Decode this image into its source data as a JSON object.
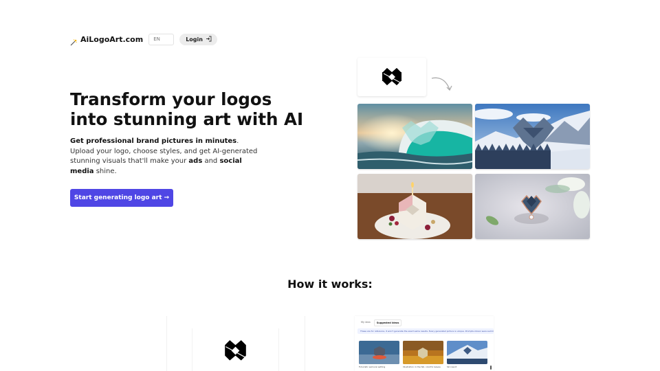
{
  "header": {
    "brand_icon": "magic-wand-icon",
    "brand_name": "AiLogoArt.com",
    "language": "EN",
    "login_label": "Login",
    "login_icon": "sign-in-icon"
  },
  "hero": {
    "title_line1": "Transform your logos",
    "title_line2": "into stunning art with AI",
    "desc_bold1": "Get professional brand pictures in minutes",
    "desc_text1": ".",
    "desc_text2": "Upload your logo, choose styles, and get AI-generated stunning visuals that'll make your ",
    "desc_bold2": "ads",
    "desc_text3": " and ",
    "desc_bold3": "social media",
    "desc_text4": " shine.",
    "cta_label": "Start generating logo art →",
    "cta_color": "#4f46e5"
  },
  "gallery": {
    "source_logo": "diamond-logo-icon",
    "arrow": "curved-arrow-icon",
    "images": [
      {
        "name": "ocean-wave-logo-art",
        "alt": "Logo as ocean wave at sunset"
      },
      {
        "name": "mountain-ski-logo-art",
        "alt": "Logo in snowy mountain landscape"
      },
      {
        "name": "cake-candle-logo-art",
        "alt": "Logo as cake with candle"
      },
      {
        "name": "ring-jewelry-logo-art",
        "alt": "Logo as gemstone ring"
      }
    ]
  },
  "how_it_works": {
    "title": "How it works:",
    "preview": {
      "tabs": [
        "My idea",
        "Suggested ideas"
      ],
      "active_tab": "Suggested ideas",
      "info": "These are for reference, it won't generate the exact same results. Every generated picture is unique. Prompts shown were summarized",
      "ideas": [
        {
          "caption": "Futuristic samurai setting"
        },
        {
          "caption": "Illustration in the fall, colorful leaves"
        },
        {
          "caption": "Ski resort"
        }
      ]
    }
  }
}
